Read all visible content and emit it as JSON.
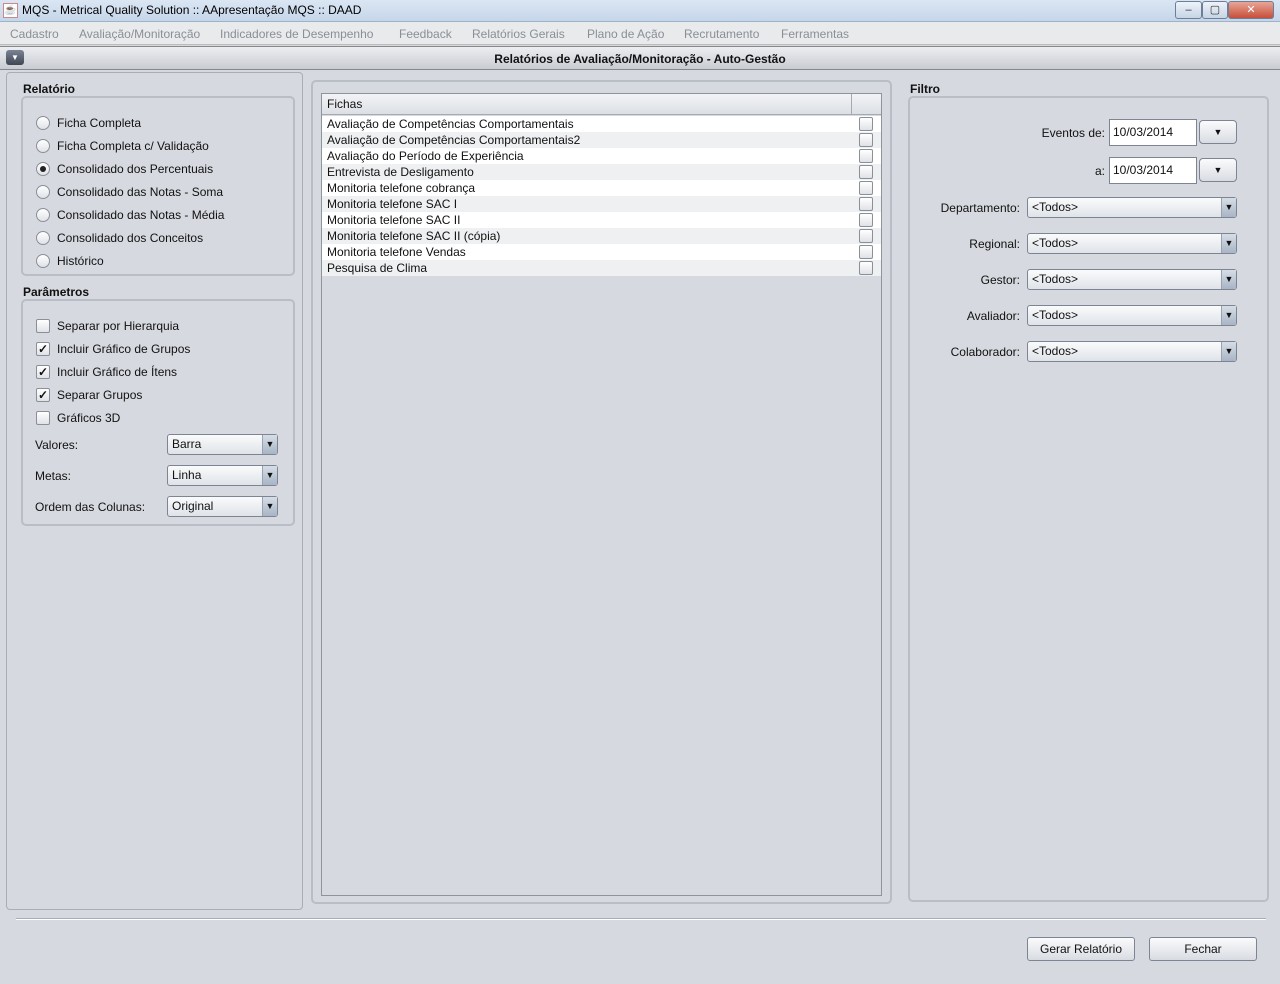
{
  "window": {
    "title": "MQS - Metrical Quality Solution :: AApresentação MQS :: DAAD",
    "minimize": "‒",
    "maximize": "▢",
    "close": "✕"
  },
  "menu": [
    "Cadastro",
    "Avaliação/Monitoração",
    "Indicadores de Desempenho",
    "Feedback",
    "Relatórios Gerais",
    "Plano de Ação",
    "Recrutamento",
    "Ferramentas"
  ],
  "frame": {
    "title": "Relatórios de Avaliação/Monitoração - Auto-Gestão"
  },
  "relatorio": {
    "label": "Relatório",
    "options": [
      {
        "label": "Ficha Completa",
        "selected": false
      },
      {
        "label": "Ficha Completa c/ Validação",
        "selected": false
      },
      {
        "label": "Consolidado dos Percentuais",
        "selected": true
      },
      {
        "label": "Consolidado das Notas - Soma",
        "selected": false
      },
      {
        "label": "Consolidado das Notas - Média",
        "selected": false
      },
      {
        "label": "Consolidado dos Conceitos",
        "selected": false
      },
      {
        "label": "Histórico",
        "selected": false
      }
    ]
  },
  "parametros": {
    "label": "Parâmetros",
    "checks": [
      {
        "label": "Separar por Hierarquia",
        "checked": false
      },
      {
        "label": "Incluir Gráfico de Grupos",
        "checked": true
      },
      {
        "label": "Incluir Gráfico de Ítens",
        "checked": true
      },
      {
        "label": "Separar Grupos",
        "checked": true
      },
      {
        "label": "Gráficos 3D",
        "checked": false
      }
    ],
    "combos": [
      {
        "label": "Valores:",
        "value": "Barra"
      },
      {
        "label": "Metas:",
        "value": "Linha"
      },
      {
        "label": "Ordem das Colunas:",
        "value": "Original"
      }
    ]
  },
  "fichas": {
    "header": "Fichas",
    "rows": [
      "Avaliação de Competências Comportamentais",
      "Avaliação de Competências Comportamentais2",
      "Avaliação do Período de Experiência",
      "Entrevista de Desligamento",
      "Monitoria telefone cobrança",
      "Monitoria telefone SAC I",
      "Monitoria telefone SAC II",
      "Monitoria telefone SAC II (cópia)",
      "Monitoria telefone Vendas",
      "Pesquisa de Clima"
    ]
  },
  "filtro": {
    "label": "Filtro",
    "eventos_de_label": "Eventos de:",
    "eventos_de": "10/03/2014",
    "a_label": "a:",
    "a": "10/03/2014",
    "combos": [
      {
        "label": "Departamento:",
        "value": "<Todos>"
      },
      {
        "label": "Regional:",
        "value": "<Todos>"
      },
      {
        "label": "Gestor:",
        "value": "<Todos>"
      },
      {
        "label": "Avaliador:",
        "value": "<Todos>"
      },
      {
        "label": "Colaborador:",
        "value": "<Todos>"
      }
    ]
  },
  "actions": {
    "gerar": "Gerar Relatório",
    "fechar": "Fechar"
  }
}
